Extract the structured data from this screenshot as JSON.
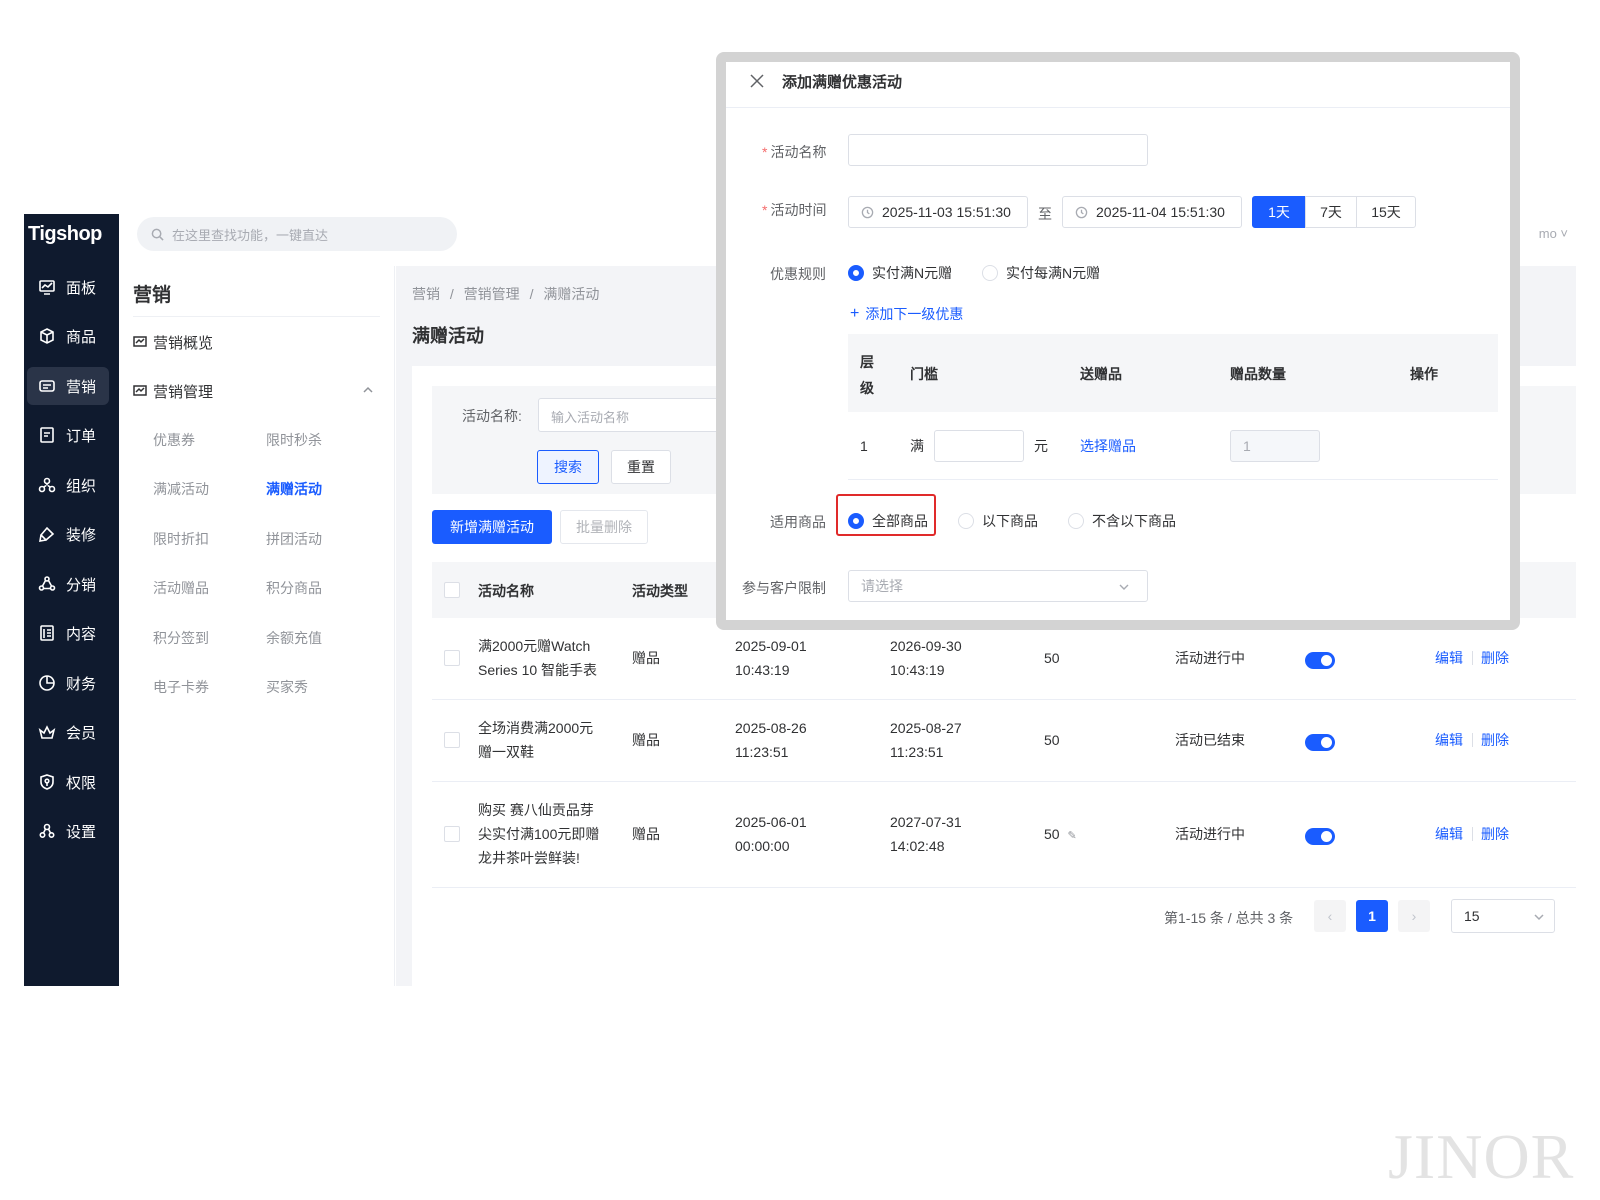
{
  "app": {
    "logo": "Tigshop",
    "user_partial": "mo ˅"
  },
  "topbar": {
    "search_placeholder": "在这里查找功能，一键直达"
  },
  "nav": {
    "items": [
      {
        "label": "面板",
        "icon": "dashboard-icon"
      },
      {
        "label": "商品",
        "icon": "box-icon"
      },
      {
        "label": "营销",
        "icon": "marketing-icon"
      },
      {
        "label": "订单",
        "icon": "order-icon"
      },
      {
        "label": "组织",
        "icon": "org-icon"
      },
      {
        "label": "装修",
        "icon": "paint-icon"
      },
      {
        "label": "分销",
        "icon": "distribution-icon"
      },
      {
        "label": "内容",
        "icon": "content-icon"
      },
      {
        "label": "财务",
        "icon": "finance-icon"
      },
      {
        "label": "会员",
        "icon": "member-icon"
      },
      {
        "label": "权限",
        "icon": "shield-icon"
      },
      {
        "label": "设置",
        "icon": "settings-icon"
      }
    ],
    "active": "营销"
  },
  "subnav": {
    "title": "营销",
    "overview": "营销概览",
    "group": "营销管理",
    "links": [
      "优惠券",
      "限时秒杀",
      "满减活动",
      "满赠活动",
      "限时折扣",
      "拼团活动",
      "活动赠品",
      "积分商品",
      "积分签到",
      "余额充值",
      "电子卡券",
      "买家秀"
    ],
    "active": "满赠活动"
  },
  "main": {
    "breadcrumb": [
      "营销",
      "/",
      "营销管理",
      "/",
      "满赠活动"
    ],
    "title": "满赠活动",
    "filter": {
      "label": "活动名称:",
      "placeholder": "输入活动名称",
      "search": "搜索",
      "reset": "重置"
    },
    "actions": {
      "add": "新增满赠活动",
      "batch_delete": "批量删除"
    },
    "table": {
      "headers": [
        "活动名称",
        "活动类型"
      ],
      "rows": [
        {
          "name_1": "满2000元赠Watch",
          "name_2": "Series 10 智能手表",
          "name_3": "",
          "type": "赠品",
          "start_d": "2025-09-01",
          "start_t": "10:43:19",
          "end_d": "2026-09-30",
          "end_t": "10:43:19",
          "limit": "50",
          "status": "活动进行中",
          "enabled": true,
          "edit": "编辑",
          "delete": "删除"
        },
        {
          "name_1": "全场消费满2000元",
          "name_2": "赠一双鞋",
          "name_3": "",
          "type": "赠品",
          "start_d": "2025-08-26",
          "start_t": "11:23:51",
          "end_d": "2025-08-27",
          "end_t": "11:23:51",
          "limit": "50",
          "status": "活动已结束",
          "enabled": true,
          "edit": "编辑",
          "delete": "删除"
        },
        {
          "name_1": "购买 赛八仙贡品芽",
          "name_2": "尖实付满100元即赠",
          "name_3": "龙井茶叶尝鲜装!",
          "type": "赠品",
          "start_d": "2025-06-01",
          "start_t": "00:00:00",
          "end_d": "2027-07-31",
          "end_t": "14:02:48",
          "limit": "50",
          "status": "活动进行中",
          "enabled": true,
          "edit": "编辑",
          "delete": "删除"
        }
      ]
    },
    "pagination": {
      "summary": "第1-15 条 / 总共 3 条",
      "current": "1",
      "page_size": "15"
    }
  },
  "dialog": {
    "title": "添加满赠优惠活动",
    "name_label": "活动名称",
    "time_label": "活动时间",
    "start_time": "2025-11-03 15:51:30",
    "to": "至",
    "end_time": "2025-11-04 15:51:30",
    "durations": [
      "1天",
      "7天",
      "15天"
    ],
    "duration_selected": "1天",
    "rule_label": "优惠规则",
    "rule_options": [
      "实付满N元赠",
      "实付每满N元赠"
    ],
    "rule_selected": "实付满N元赠",
    "add_level": "添加下一级优惠",
    "gift_table": {
      "headers": {
        "level_1": "层",
        "level_2": "级",
        "threshold": "门槛",
        "gift": "送赠品",
        "qty": "赠品数量",
        "op": "操作"
      },
      "row": {
        "level": "1",
        "man": "满",
        "yuan": "元",
        "choose_gift": "选择赠品",
        "qty_value": "1"
      }
    },
    "scope_label": "适用商品",
    "scope_options": [
      "全部商品",
      "以下商品",
      "不含以下商品"
    ],
    "scope_selected": "全部商品",
    "limit_label": "参与客户限制",
    "limit_placeholder": "请选择"
  },
  "watermark": "JINOR",
  "colors": {
    "primary": "#1a5cff",
    "nav_bg": "#0f1a2e",
    "highlight": "#e02a2a"
  }
}
